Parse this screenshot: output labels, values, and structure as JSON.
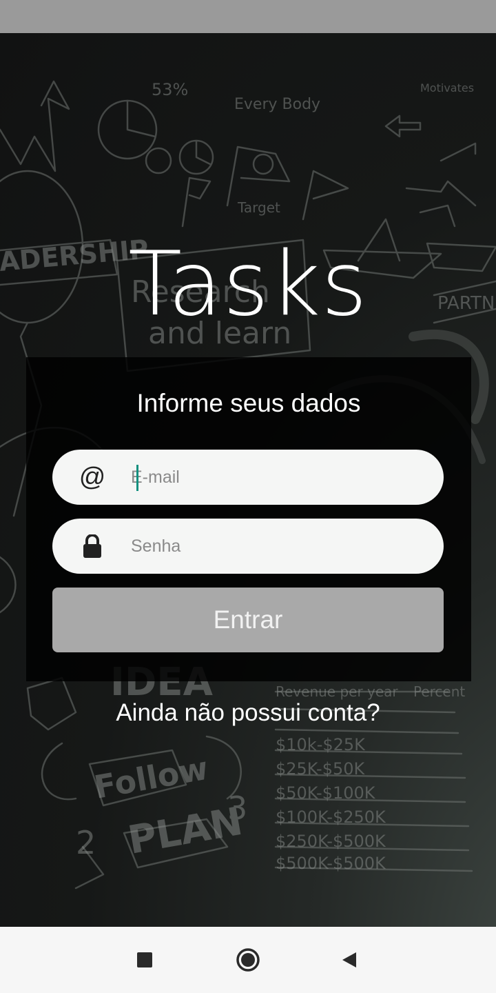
{
  "app": {
    "title": "Tasks"
  },
  "form": {
    "subtitle": "Informe seus dados",
    "email": {
      "icon": "at-icon",
      "icon_glyph": "@",
      "placeholder": "E-mail",
      "value": ""
    },
    "password": {
      "icon": "lock-icon",
      "placeholder": "Senha",
      "value": ""
    },
    "submit_label": "Entrar",
    "submit_color": "#a9a9a9"
  },
  "signup_link": "Ainda não possui conta?",
  "colors": {
    "caret": "#11907f",
    "status_bar": "#9a9a9a",
    "nav_bar": "#f6f6f6"
  },
  "nav": {
    "recents_icon": "square-recents-icon",
    "home_icon": "circle-home-icon",
    "back_icon": "triangle-back-icon"
  }
}
